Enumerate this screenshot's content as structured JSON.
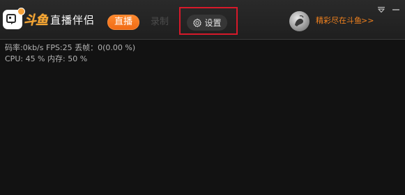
{
  "app": {
    "logo_text": "斗鱼",
    "title": "直播伴侣"
  },
  "tabs": {
    "live_label": "直播",
    "record_label": "录制"
  },
  "settings": {
    "label": "设置",
    "icon": "gear-icon"
  },
  "user": {
    "promo_text": "精彩尽在斗鱼",
    "promo_arrow": ">>"
  },
  "window_controls": {
    "dropdown_icon": "dropdown-triangle-icon",
    "minimize_icon": "minimize-icon"
  },
  "stats": {
    "line1": "码率:0kb/s  FPS:25  丢帧：0(0.00 %)",
    "line2": "CPU: 45 %   内存: 50 %"
  },
  "colors": {
    "accent_orange": "#f06a14",
    "highlight_red": "#d7192a",
    "background": "#121212"
  }
}
